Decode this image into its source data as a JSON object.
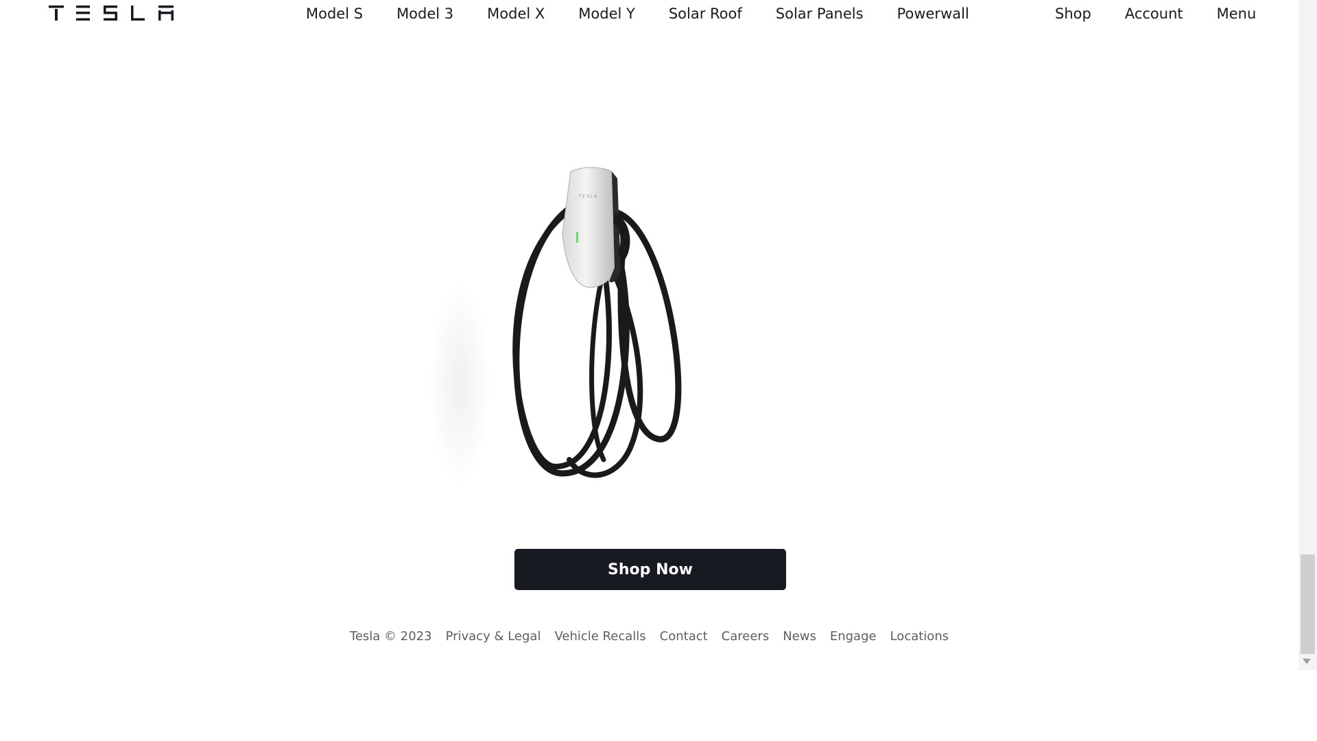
{
  "header": {
    "logo_text": "TESLA",
    "nav_main": [
      "Model S",
      "Model 3",
      "Model X",
      "Model Y",
      "Solar Roof",
      "Solar Panels",
      "Powerwall"
    ],
    "nav_right": [
      "Shop",
      "Account",
      "Menu"
    ]
  },
  "product": {
    "image_icon": "wall-connector-icon",
    "device_brand_text": "TESLA"
  },
  "cta": {
    "shop_now_label": "Shop Now"
  },
  "footer": {
    "copyright": "Tesla © 2023",
    "links": [
      "Privacy & Legal",
      "Vehicle Recalls",
      "Contact",
      "Careers",
      "News",
      "Engage",
      "Locations"
    ]
  },
  "colors": {
    "text_primary": "#171a20",
    "text_secondary": "#5c5e62",
    "button_bg": "#171a20",
    "button_text": "#ffffff",
    "background": "#ffffff",
    "indicator_green": "#6fd66f"
  }
}
